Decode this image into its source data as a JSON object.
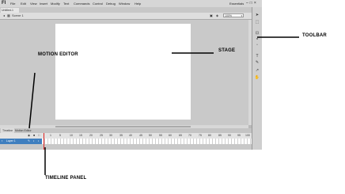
{
  "app": {
    "logo": "Fl"
  },
  "menubar": {
    "items": [
      "File",
      "Edit",
      "View",
      "Insert",
      "Modify",
      "Text",
      "Commands",
      "Control",
      "Debug",
      "Window",
      "Help"
    ],
    "workspace": "Essentials"
  },
  "document": {
    "tab_label": "Untitled-1"
  },
  "editbar": {
    "scene_label": "Scene 1",
    "zoom_value": "100%"
  },
  "timeline": {
    "tabs": [
      "Timeline",
      "Motion Editor"
    ],
    "frame_numbers": [
      "1",
      "5",
      "10",
      "15",
      "20",
      "25",
      "30",
      "35",
      "40",
      "45",
      "50",
      "55",
      "60",
      "65",
      "70",
      "75",
      "80",
      "85",
      "90",
      "95",
      "100"
    ],
    "layer_name": "Layer 1"
  },
  "annotations": {
    "motion_editor": "MOTION EDITOR",
    "stage": "STAGE",
    "toolbar": "TOOLBAR",
    "timeline_panel": "TIMELINE PANEL"
  },
  "colors": {
    "layer_selected": "#3f7fbf",
    "playhead": "#dd2222",
    "stage": "#ffffff",
    "workspace": "#c9c9c9"
  }
}
